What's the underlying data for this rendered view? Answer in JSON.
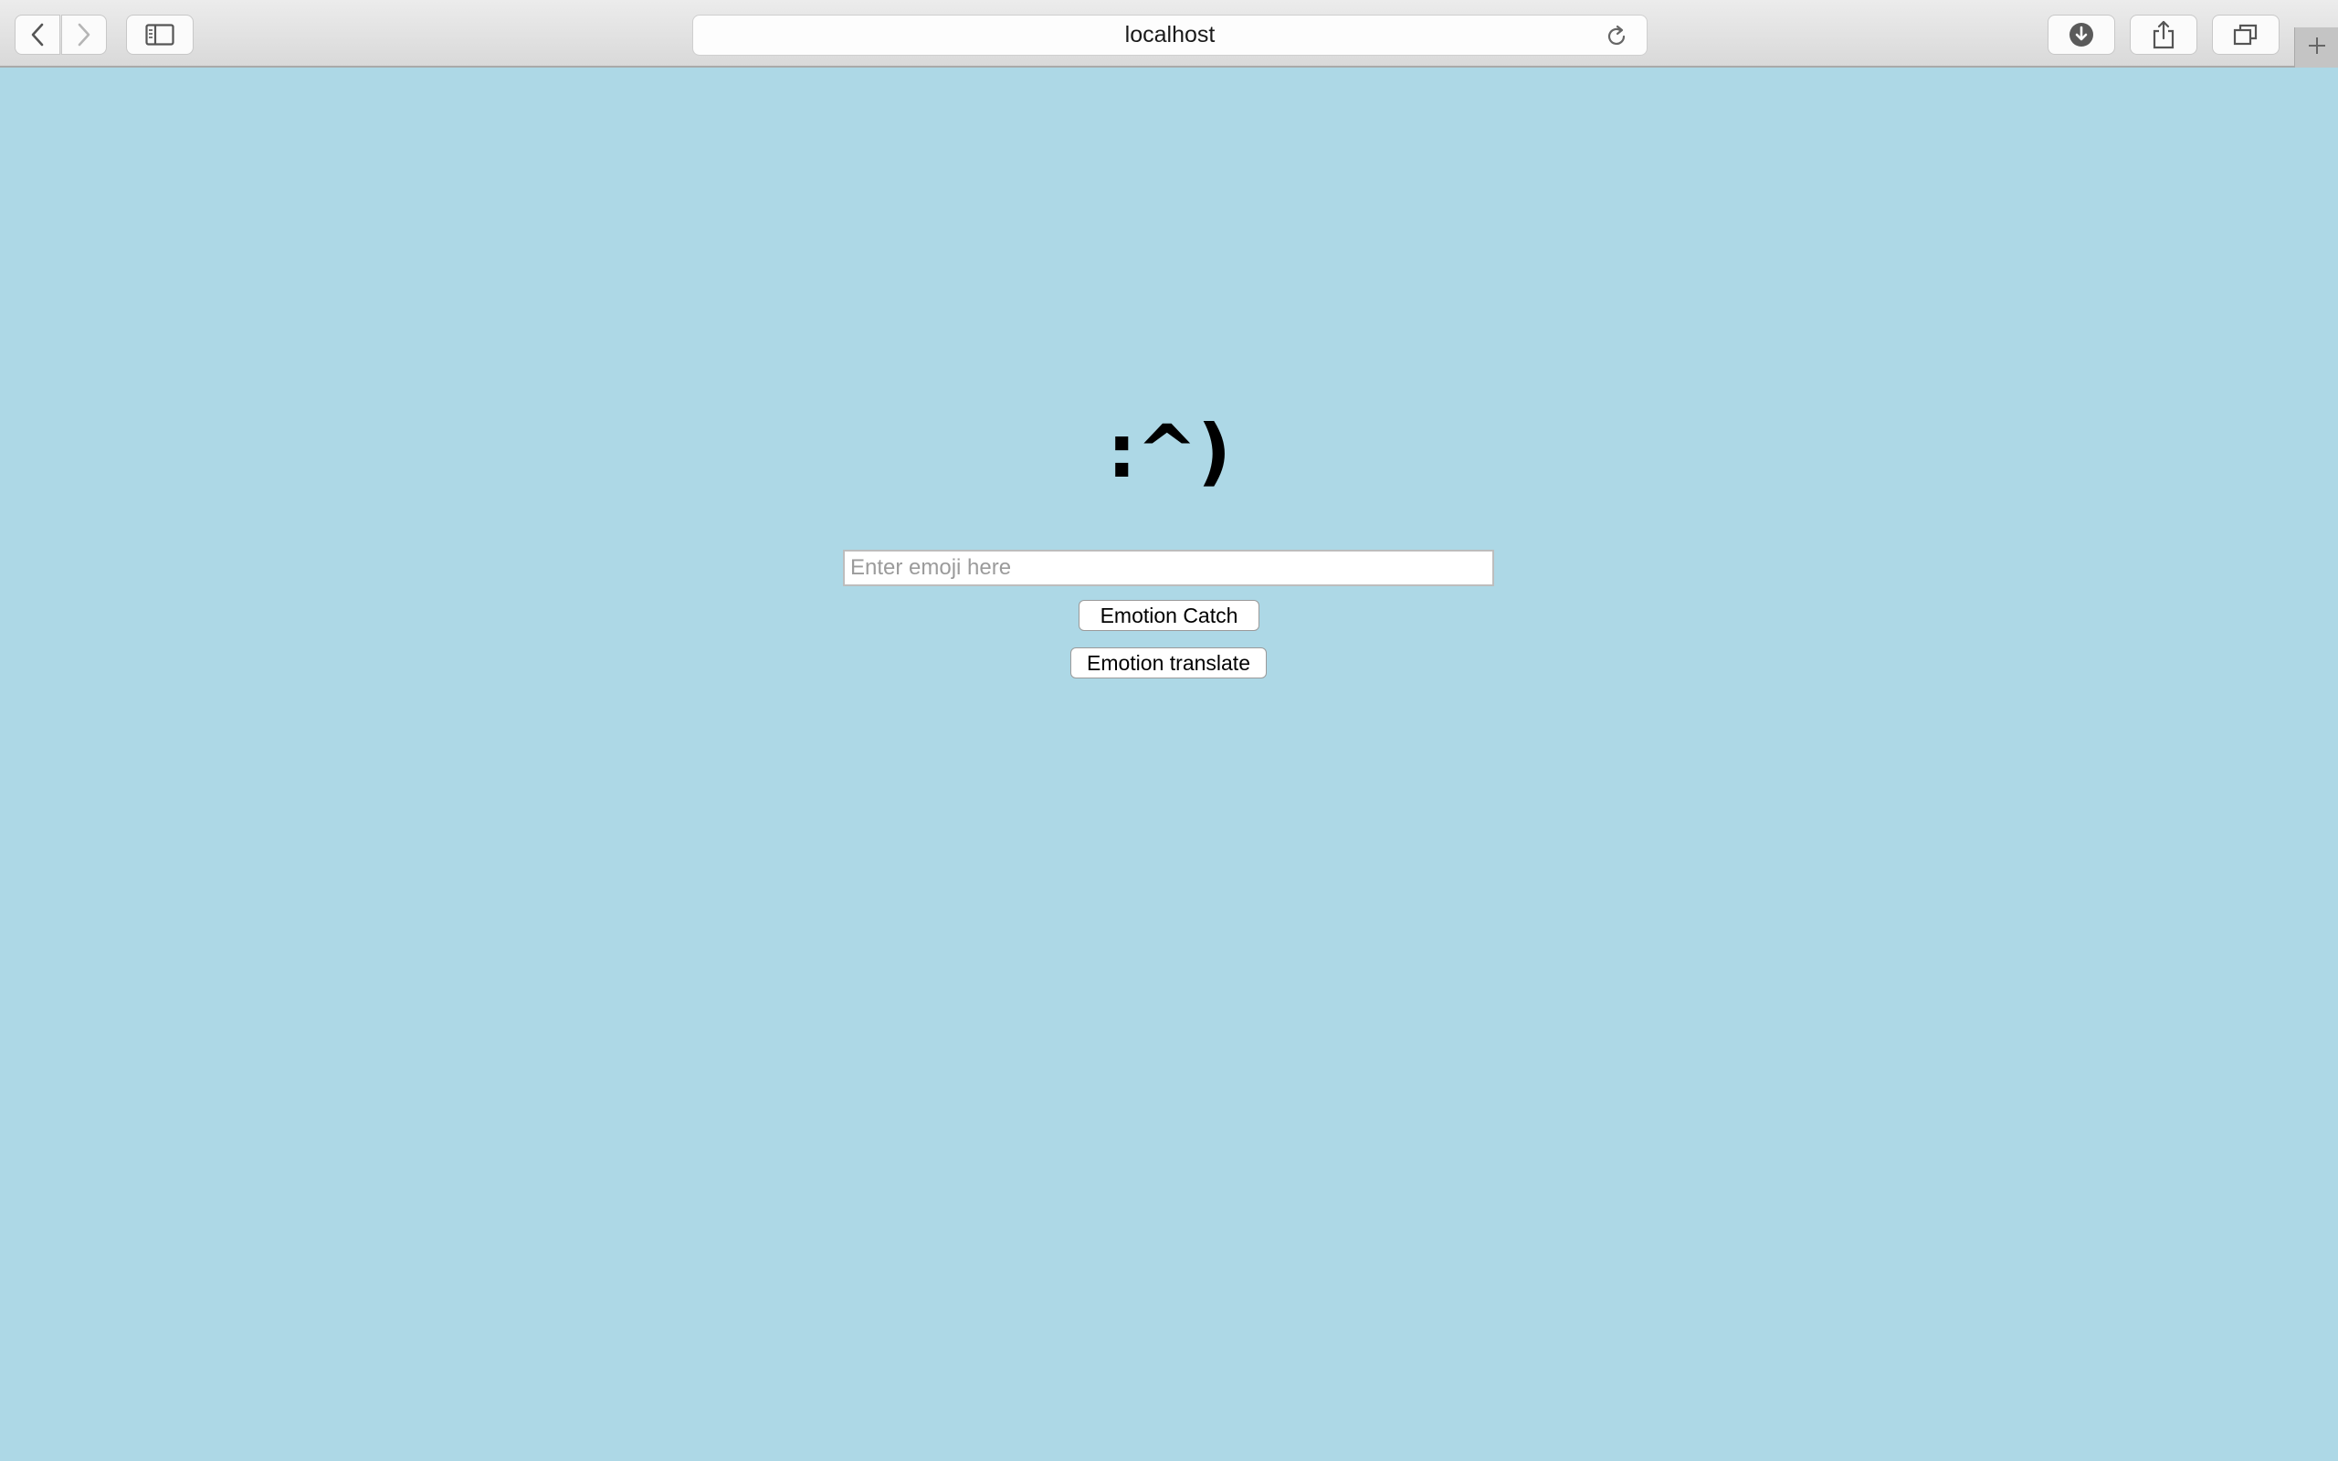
{
  "browser": {
    "address": "localhost",
    "icons": {
      "back": "chevron-left-icon",
      "forward": "chevron-right-icon",
      "sidebar": "sidebar-icon",
      "reload": "reload-icon",
      "download": "download-icon",
      "share": "share-icon",
      "tabs": "tabs-overview-icon",
      "new_tab": "plus-icon"
    }
  },
  "page": {
    "background_color": "#add8e6",
    "heading": ":^)",
    "input": {
      "placeholder": "Enter emoji here",
      "value": ""
    },
    "buttons": {
      "catch": "Emotion Catch",
      "translate": "Emotion translate"
    }
  }
}
